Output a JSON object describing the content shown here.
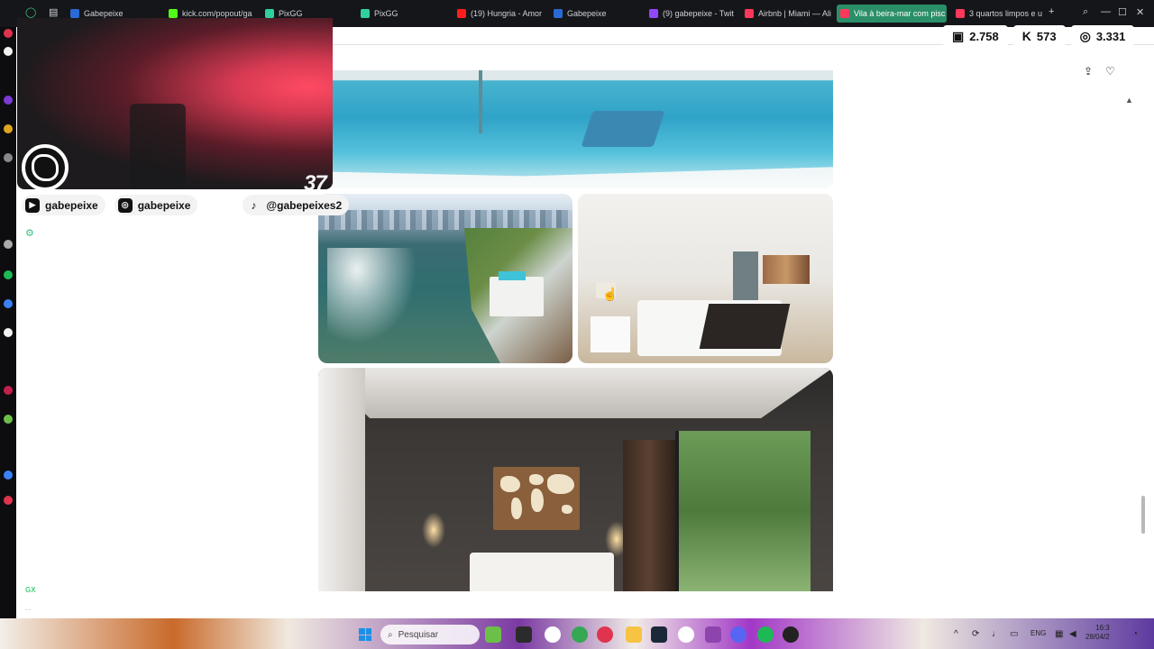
{
  "browser": {
    "tabs": [
      {
        "label": "Gabepeixe",
        "fav": "#2a6ad6",
        "active": false
      },
      {
        "label": "kick.com/popout/ga",
        "fav": "#53fc18",
        "active": false
      },
      {
        "label": "PixGG",
        "fav": "#2fd0a0",
        "active": false
      },
      {
        "label": "PixGG",
        "fav": "#2fd0a0",
        "active": false
      },
      {
        "label": "(19) Hungria - Amor",
        "fav": "#ff1e1e",
        "active": false
      },
      {
        "label": "Gabepeixe",
        "fav": "#2a6ad6",
        "active": false
      },
      {
        "label": "(9) gabepeixe - Twit",
        "fav": "#9146ff",
        "active": false
      },
      {
        "label": "Airbnb | Miami — Ali",
        "fav": "#ff385c",
        "active": false
      },
      {
        "label": "Vila à beira-mar com pisc",
        "fav": "#ff385c",
        "active": true
      },
      {
        "label": "3 quartos limpos e ur",
        "fav": "#ff385c",
        "active": false
      }
    ],
    "new_tab": "+"
  },
  "stream_stats": {
    "twitch": "2.758",
    "kick": "573",
    "total": "3.331"
  },
  "cam": {
    "counter": "37"
  },
  "socials": [
    {
      "icon": "youtube-icon",
      "handle": "gabepeixe"
    },
    {
      "icon": "instagram-icon",
      "handle": "gabepeixe"
    },
    {
      "icon": "tiktok-icon",
      "handle": "@gabepeixes2"
    }
  ],
  "page": {
    "photos": [
      "pool",
      "bay",
      "bedroom",
      "master-bedroom"
    ]
  },
  "sidebar": {
    "gx_label": "GX",
    "more_label": "..."
  },
  "taskbar": {
    "search_placeholder": "Pesquisar",
    "lang": "ENG",
    "time": "16:3",
    "date": "28/04/2"
  }
}
